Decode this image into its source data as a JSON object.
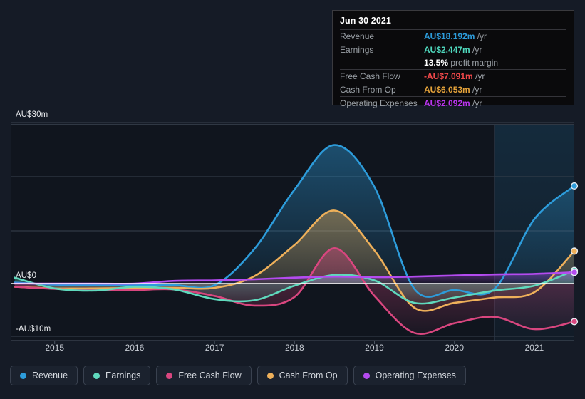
{
  "axis": {
    "y_ticks": [
      {
        "label": "AU$30m",
        "value": 30
      },
      {
        "label": "AU$0",
        "value": 0
      },
      {
        "label": "-AU$10m",
        "value": -10
      }
    ],
    "x_ticks": [
      "2015",
      "2016",
      "2017",
      "2018",
      "2019",
      "2020",
      "2021"
    ]
  },
  "tooltip": {
    "title": "Jun 30 2021",
    "rows": [
      {
        "key": "Revenue",
        "amount": "AU$18.192m",
        "unit": "/yr",
        "color": "#2d9cdb"
      },
      {
        "key": "Earnings",
        "amount": "AU$2.447m",
        "unit": "/yr",
        "color": "#4fd8bd"
      },
      {
        "key": "Free Cash Flow",
        "amount": "-AU$7.091m",
        "unit": "/yr",
        "color": "#f0484a"
      },
      {
        "key": "Cash From Op",
        "amount": "AU$6.053m",
        "unit": "/yr",
        "color": "#e5a33a"
      },
      {
        "key": "Operating Expenses",
        "amount": "AU$2.092m",
        "unit": "/yr",
        "color": "#b936ef"
      }
    ],
    "margin": {
      "value": "13.5%",
      "text": "profit margin"
    }
  },
  "legend": {
    "items": [
      {
        "label": "Revenue",
        "color": "#2d9cdb"
      },
      {
        "label": "Earnings",
        "color": "#5fd9bd"
      },
      {
        "label": "Free Cash Flow",
        "color": "#d9467f"
      },
      {
        "label": "Cash From Op",
        "color": "#eeb05a"
      },
      {
        "label": "Operating Expenses",
        "color": "#b44bf0"
      }
    ]
  },
  "chart_data": {
    "type": "line",
    "title": "",
    "xlabel": "",
    "ylabel": "AU$",
    "ylim": [
      -13,
      30
    ],
    "xlim": [
      2014.45,
      2021.5
    ],
    "grid": true,
    "legend_position": "bottom",
    "zero_line": 0,
    "highlight_band": {
      "from": 2020.5,
      "to": 2021.5,
      "label": "forecast"
    },
    "x": [
      2014.5,
      2015.0,
      2015.5,
      2016.0,
      2016.5,
      2017.0,
      2017.5,
      2018.0,
      2018.5,
      2019.0,
      2019.5,
      2020.0,
      2020.5,
      2021.0,
      2021.5
    ],
    "series": [
      {
        "name": "Revenue",
        "color": "#2d9cdb",
        "values": [
          0.2,
          -0.2,
          -0.3,
          -0.3,
          -0.3,
          -0.3,
          6.5,
          17.5,
          25.8,
          18.0,
          -1.0,
          -1.2,
          -1.0,
          12.0,
          18.192
        ],
        "end_value": 18.192
      },
      {
        "name": "Earnings",
        "color": "#5fd9bd",
        "values": [
          1.1,
          -0.9,
          -1.3,
          -0.6,
          -1.1,
          -2.9,
          -3.1,
          -0.4,
          1.6,
          0.6,
          -3.6,
          -2.6,
          -1.3,
          -0.4,
          2.447
        ],
        "end_value": 2.447
      },
      {
        "name": "Free Cash Flow",
        "color": "#d9467f",
        "values": [
          -0.6,
          -1.0,
          -1.2,
          -1.2,
          -1.1,
          -2.3,
          -4.1,
          -2.5,
          6.6,
          -2.3,
          -9.2,
          -7.4,
          -6.2,
          -8.5,
          -7.091
        ],
        "end_value": -7.091
      },
      {
        "name": "Cash From Op",
        "color": "#eeb05a",
        "values": [
          -0.6,
          -0.9,
          -0.9,
          -0.8,
          -0.8,
          -0.8,
          1.4,
          7.2,
          13.6,
          6.2,
          -4.5,
          -3.6,
          -2.6,
          -1.6,
          6.053
        ],
        "end_value": 6.053
      },
      {
        "name": "Operating Expenses",
        "color": "#b44bf0",
        "values": [
          0,
          0,
          0,
          0,
          0.5,
          0.6,
          0.8,
          1.1,
          1.3,
          1.2,
          1.3,
          1.5,
          1.7,
          1.8,
          2.092
        ],
        "end_value": 2.092
      }
    ]
  }
}
